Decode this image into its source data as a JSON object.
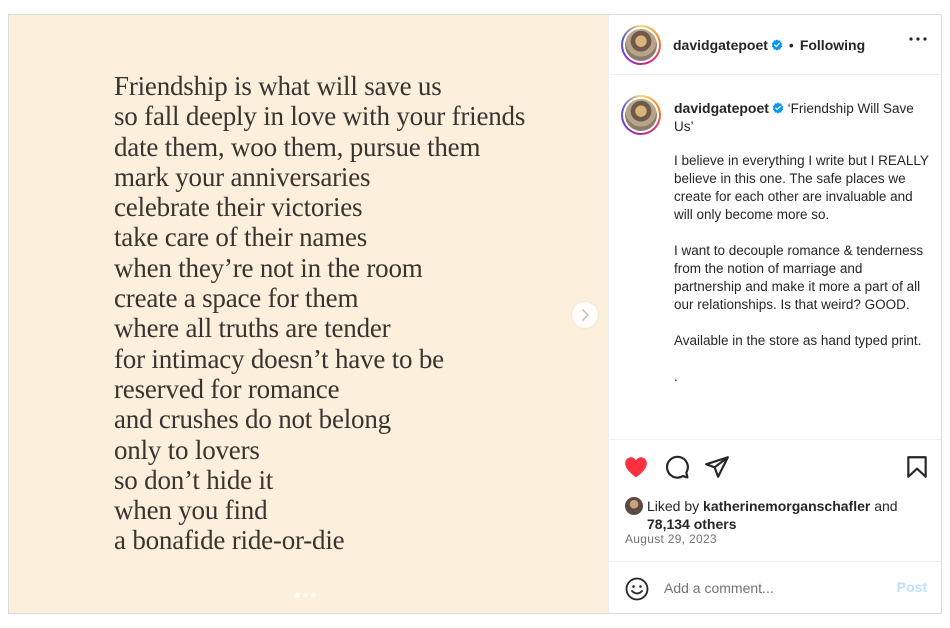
{
  "media": {
    "poem_lines": [
      "Friendship is what will save us",
      "so fall deeply in love with your friends",
      "date them, woo them, pursue them",
      "mark your anniversaries",
      "celebrate their victories",
      "take care of their names",
      "when they’re not in the room",
      "create a space for them",
      "where all truths are tender",
      "for intimacy doesn’t have to be",
      "reserved for romance",
      "and crushes do not belong",
      "only to lovers",
      "so don’t hide it",
      "when you find",
      "a bonafide ride-or-die"
    ],
    "background_color": "#fcf0dd",
    "carousel_dots": 3,
    "active_dot": 0
  },
  "header": {
    "username": "davidgatepoet",
    "separator": "•",
    "follow_status": "Following"
  },
  "caption": {
    "username": "davidgatepoet",
    "title": "‘Friendship Will Save Us’",
    "paragraphs": [
      "I believe in everything I write but I REALLY believe in this one. The safe places we create for each other are invaluable and will only become more so.",
      "I want to decouple romance & tenderness from the notion of marriage and partnership and make it more a part of all our relationships. Is that weird? GOOD.",
      "Available in the store as hand typed print.",
      "."
    ]
  },
  "actions": {
    "liked": true,
    "like_color": "#ff3040"
  },
  "likes": {
    "prefix": "Liked by",
    "user": "katherinemorganschafler",
    "connector": "and",
    "others": "78,134 others"
  },
  "date": "August 29, 2023",
  "comment": {
    "placeholder": "Add a comment...",
    "post_label": "Post"
  },
  "colors": {
    "verified": "#0095f6",
    "post_disabled": "#c0dffd"
  }
}
